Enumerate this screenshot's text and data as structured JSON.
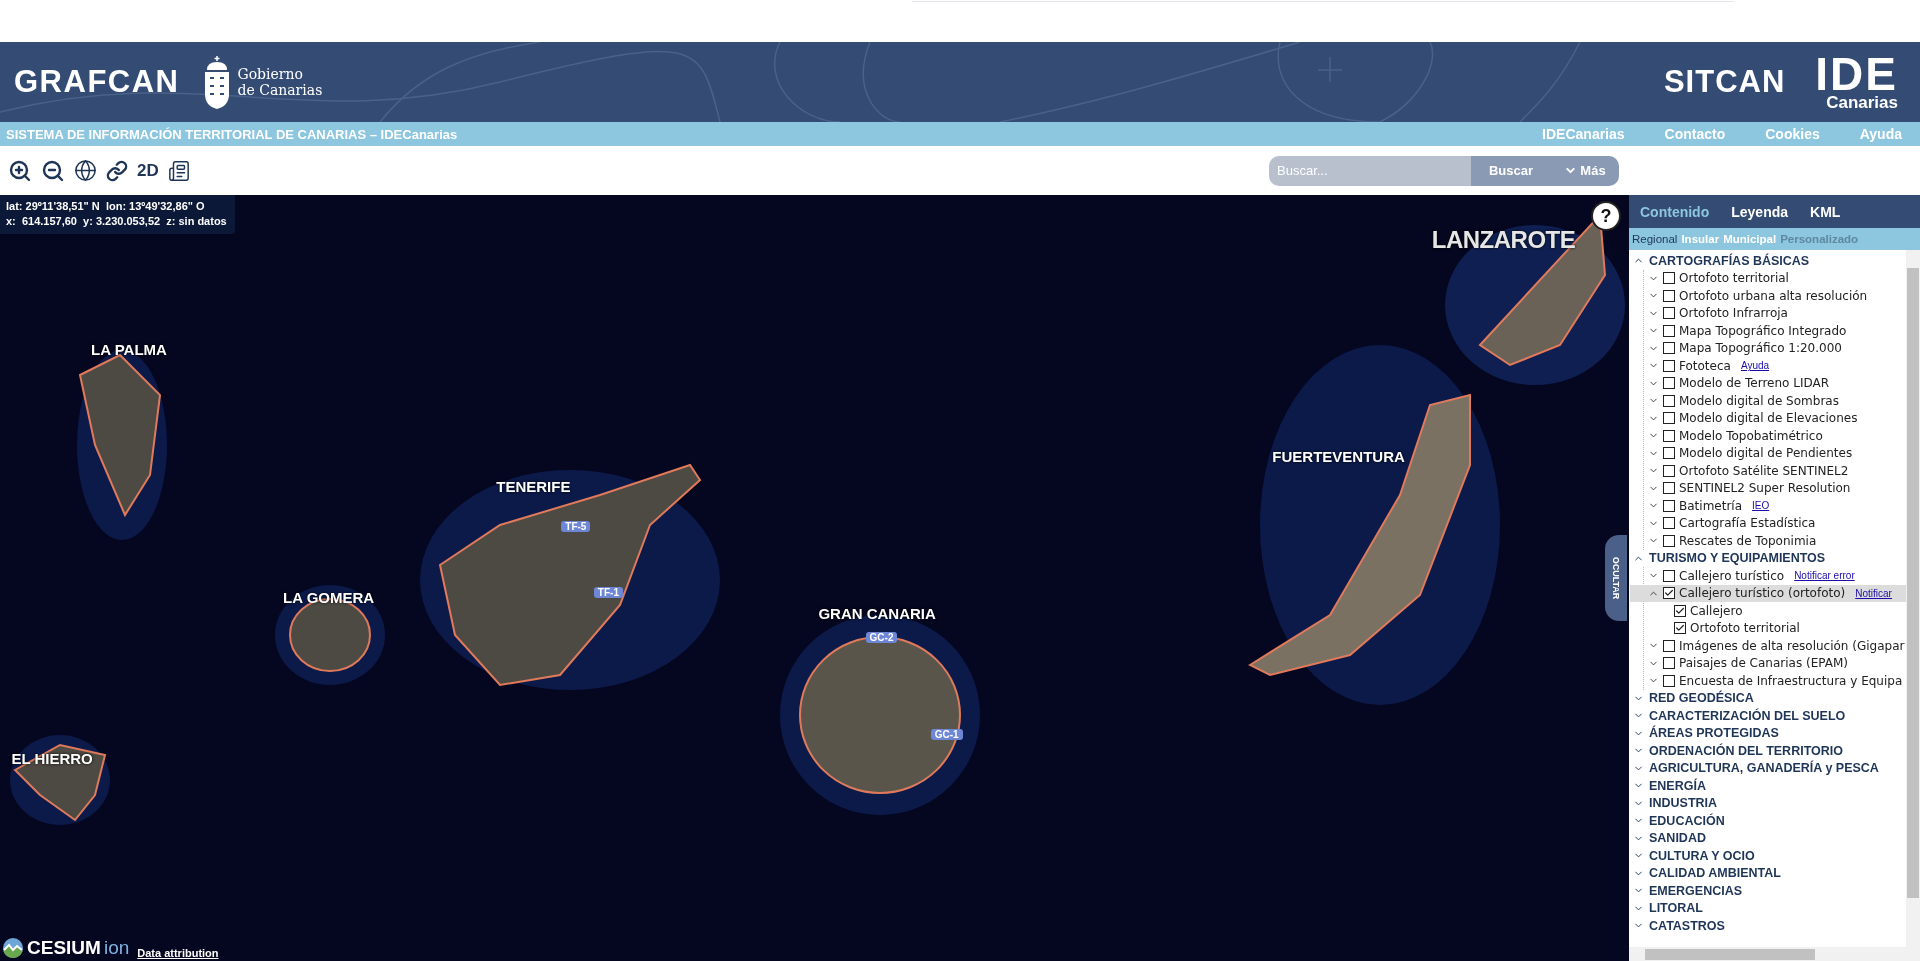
{
  "header": {
    "brand": "GRAFCAN",
    "government_line1": "Gobierno",
    "government_line2": "de Canarias",
    "sitcan": "SITCAN",
    "ide": "IDE",
    "ide_sub": "Canarias"
  },
  "site_bar": {
    "title": "SISTEMA DE INFORMACIÓN TERRITORIAL DE CANARIAS – IDECanarias",
    "links": [
      "IDECanarias",
      "Contacto",
      "Cookies",
      "Ayuda"
    ]
  },
  "toolbar": {
    "tools": [
      {
        "kind": "zoom-in"
      },
      {
        "kind": "zoom-out"
      },
      {
        "kind": "globe"
      },
      {
        "kind": "link"
      },
      {
        "kind": "text",
        "label": "2D"
      },
      {
        "kind": "news"
      }
    ],
    "search": {
      "placeholder": "Buscar...",
      "button": "Buscar",
      "more": "Más"
    }
  },
  "map": {
    "coords_line1": "lat: 29º11'38,51\" N  lon: 13º49'32,86\" O",
    "coords_line2": "x:  614.157,60  y: 3.230.053,52  z: sin datos",
    "help": "?",
    "hide_tab": "OCULTAR",
    "attribution": "Data attribution",
    "logo": "CESIUM",
    "logo_sub": "ion",
    "labels": [
      {
        "text": "LANZAROTE",
        "kind": "large"
      },
      {
        "text": "LA PALMA",
        "kind": "island"
      },
      {
        "text": "FUERTEVENTURA",
        "kind": "island"
      },
      {
        "text": "TENERIFE",
        "kind": "island"
      },
      {
        "text": "LA GOMERA",
        "kind": "island"
      },
      {
        "text": "GRAN CANARIA",
        "kind": "island"
      },
      {
        "text": "EL HIERRO",
        "kind": "island"
      },
      {
        "text": "TF-5",
        "kind": "road"
      },
      {
        "text": "TF-1",
        "kind": "road"
      },
      {
        "text": "GC-2",
        "kind": "road"
      },
      {
        "text": "GC-1",
        "kind": "road"
      }
    ]
  },
  "panel": {
    "tabs": [
      {
        "label": "Contenido",
        "selected": true
      },
      {
        "label": "Leyenda",
        "selected": false
      },
      {
        "label": "KML",
        "selected": false
      }
    ],
    "scopes": [
      {
        "label": "Regional",
        "selected": true,
        "disabled": false
      },
      {
        "label": "Insular",
        "selected": false,
        "disabled": false
      },
      {
        "label": "Municipal",
        "selected": false,
        "disabled": false
      },
      {
        "label": "Personalizado",
        "selected": false,
        "disabled": true
      }
    ],
    "groups": [
      {
        "label": "CARTOGRAFÍAS BÁSICAS",
        "expanded": true,
        "items": [
          {
            "label": "Ortofoto territorial",
            "expanded": false,
            "checked": false,
            "selected": false
          },
          {
            "label": "Ortofoto urbana alta resolución",
            "expanded": false,
            "checked": false,
            "selected": false
          },
          {
            "label": "Ortofoto Infrarroja",
            "expanded": false,
            "checked": false,
            "selected": false
          },
          {
            "label": "Mapa Topográfico Integrado",
            "expanded": false,
            "checked": false,
            "selected": false
          },
          {
            "label": "Mapa Topográfico 1:20.000",
            "expanded": false,
            "checked": false,
            "selected": false
          },
          {
            "label": "Fototeca",
            "link": "Ayuda",
            "expanded": false,
            "checked": false,
            "selected": false
          },
          {
            "label": "Modelo de Terreno LIDAR",
            "expanded": false,
            "checked": false,
            "selected": false
          },
          {
            "label": "Modelo digital de Sombras",
            "expanded": false,
            "checked": false,
            "selected": false
          },
          {
            "label": "Modelo digital de Elevaciones",
            "expanded": false,
            "checked": false,
            "selected": false
          },
          {
            "label": "Modelo Topobatimétrico",
            "expanded": false,
            "checked": false,
            "selected": false
          },
          {
            "label": "Modelo digital de Pendientes",
            "expanded": false,
            "checked": false,
            "selected": false
          },
          {
            "label": "Ortofoto Satélite SENTINEL2",
            "expanded": false,
            "checked": false,
            "selected": false
          },
          {
            "label": "SENTINEL2 Super Resolution",
            "expanded": false,
            "checked": false,
            "selected": false
          },
          {
            "label": "Batimetría",
            "link": "IEO",
            "expanded": false,
            "checked": false,
            "selected": false
          },
          {
            "label": "Cartografía Estadística",
            "expanded": false,
            "checked": false,
            "selected": false
          },
          {
            "label": "Rescates de Toponimia",
            "expanded": false,
            "checked": false,
            "selected": false
          }
        ]
      },
      {
        "label": "TURISMO Y EQUIPAMIENTOS",
        "expanded": true,
        "items": [
          {
            "label": "Callejero turístico",
            "link": "Notificar error",
            "expanded": false,
            "checked": false,
            "selected": false
          },
          {
            "label": "Callejero turístico (ortofoto)",
            "link": "Notificar",
            "expanded": true,
            "checked": true,
            "selected": true,
            "children": [
              {
                "label": "Callejero",
                "checked": true
              },
              {
                "label": "Ortofoto territorial",
                "checked": true
              }
            ]
          },
          {
            "label": "Imágenes de alta resolución (Gigapar",
            "expanded": false,
            "checked": false,
            "selected": false
          },
          {
            "label": "Paisajes de Canarias (EPAM)",
            "expanded": false,
            "checked": false,
            "selected": false
          },
          {
            "label": "Encuesta de Infraestructura y Equipa",
            "expanded": false,
            "checked": false,
            "selected": false
          }
        ]
      },
      {
        "label": "RED GEODÉSICA",
        "expanded": false
      },
      {
        "label": "CARACTERIZACIÓN DEL SUELO",
        "expanded": false
      },
      {
        "label": "ÁREAS PROTEGIDAS",
        "expanded": false
      },
      {
        "label": "ORDENACIÓN DEL TERRITORIO",
        "expanded": false
      },
      {
        "label": "AGRICULTURA, GANADERÍA y PESCA",
        "expanded": false
      },
      {
        "label": "ENERGÍA",
        "expanded": false
      },
      {
        "label": "INDUSTRIA",
        "expanded": false
      },
      {
        "label": "EDUCACIÓN",
        "expanded": false
      },
      {
        "label": "SANIDAD",
        "expanded": false
      },
      {
        "label": "CULTURA Y OCIO",
        "expanded": false
      },
      {
        "label": "CALIDAD AMBIENTAL",
        "expanded": false
      },
      {
        "label": "EMERGENCIAS",
        "expanded": false
      },
      {
        "label": "LITORAL",
        "expanded": false
      },
      {
        "label": "CATASTROS",
        "expanded": false
      }
    ]
  }
}
